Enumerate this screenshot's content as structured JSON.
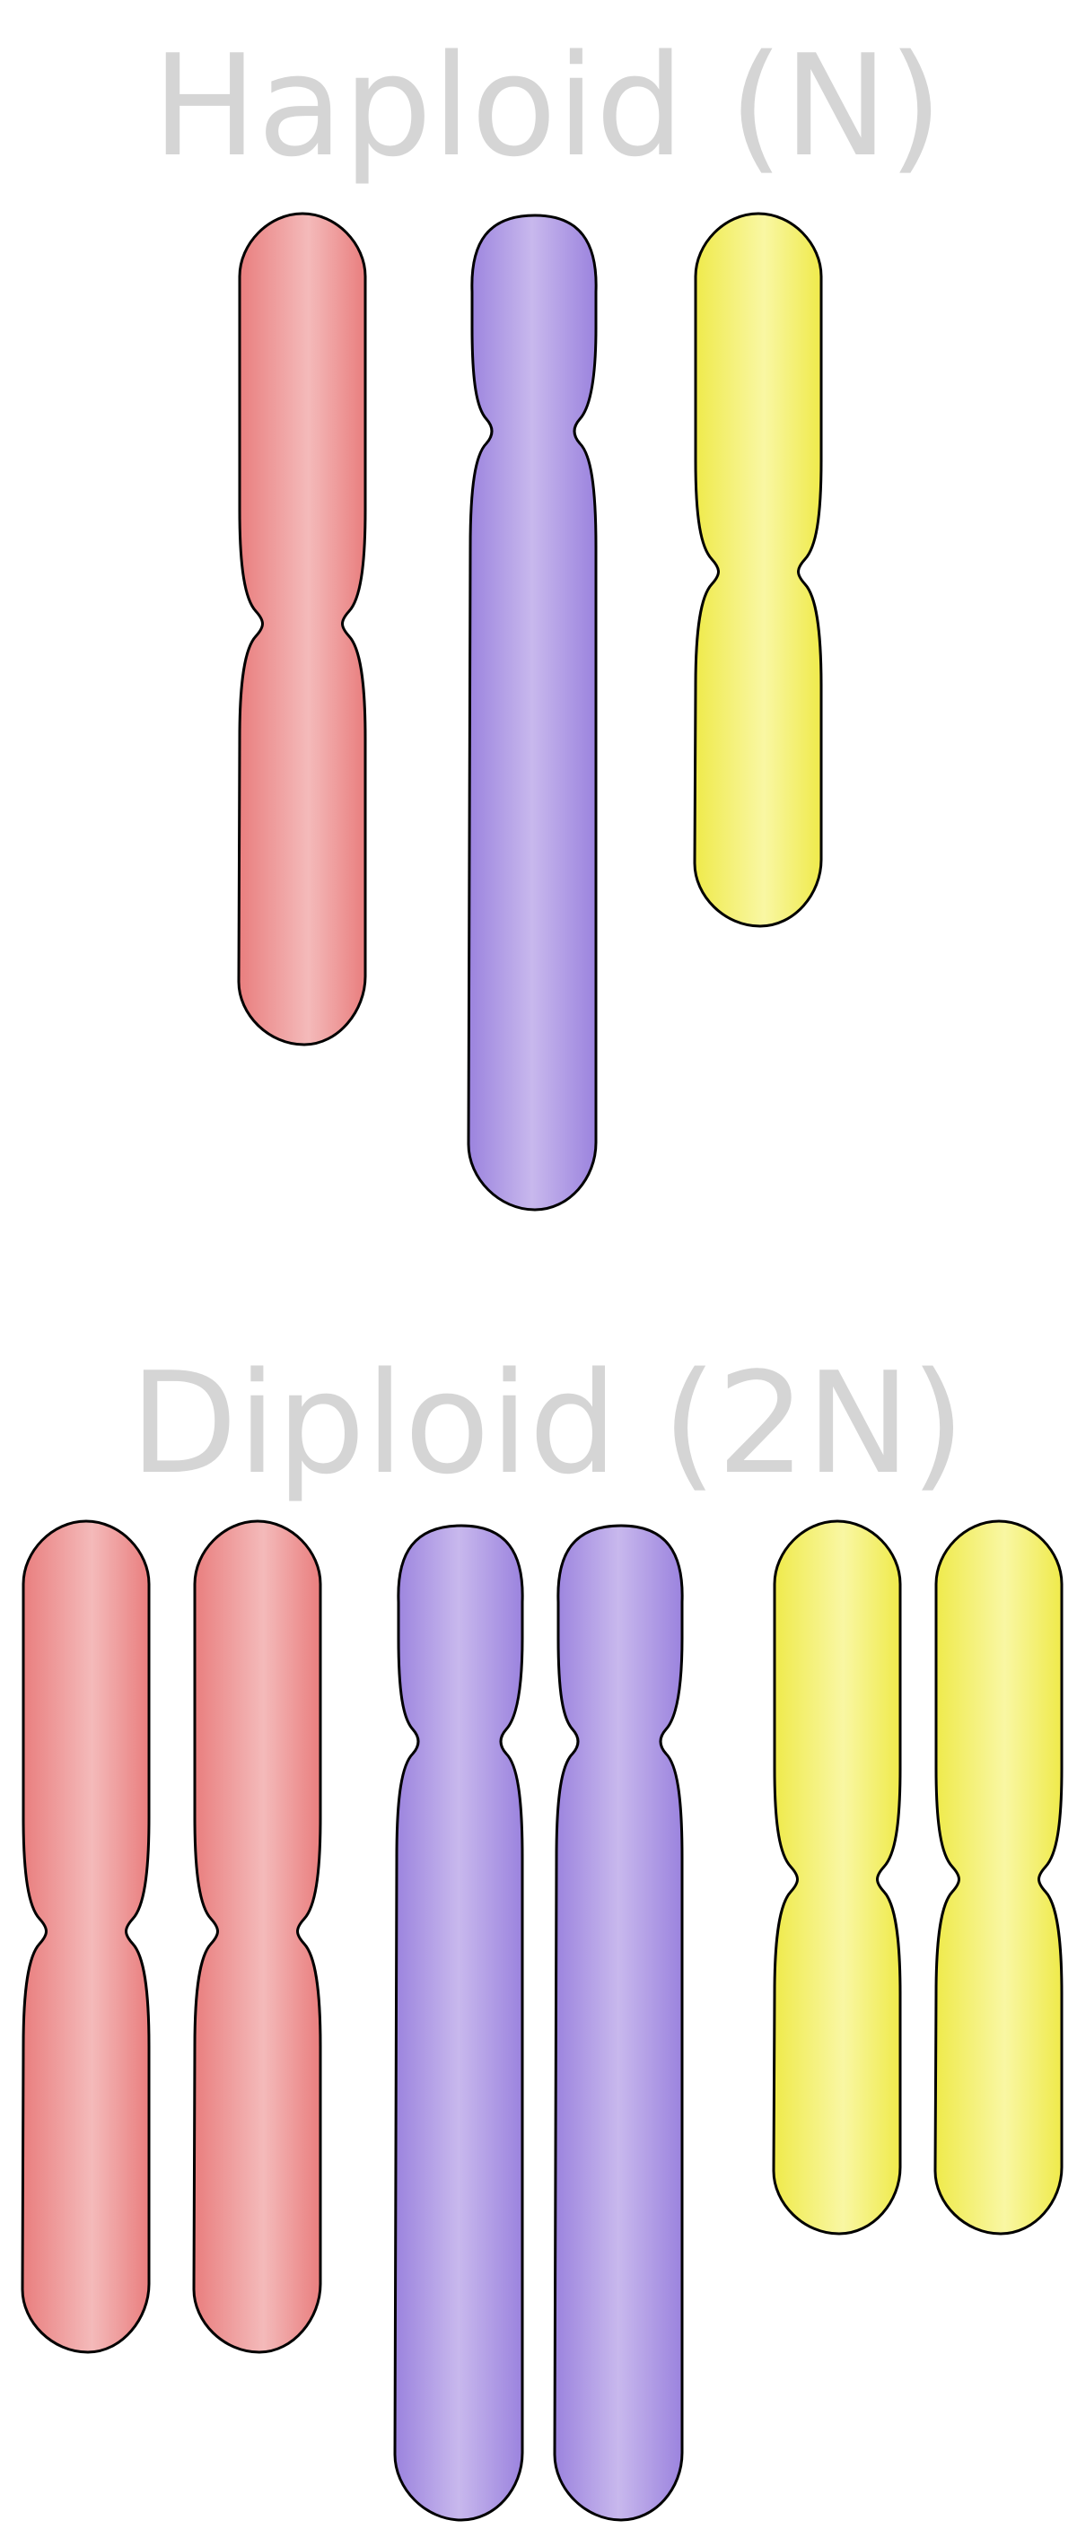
{
  "diagram": {
    "haploid_title": "Haploid (N)",
    "diploid_title": "Diploid (2N)"
  },
  "colors": {
    "red": {
      "edge": "#e97e7e",
      "mid": "#f4baba"
    },
    "purple": {
      "edge": "#9b83de",
      "mid": "#c8b8ed"
    },
    "yellow": {
      "edge": "#efea4b",
      "mid": "#f9f7a3"
    },
    "title": "#d5d5d5",
    "outline": "#000000"
  },
  "haploid_set": [
    {
      "name": "red",
      "centromere": "metacentric"
    },
    {
      "name": "purple",
      "centromere": "submetacentric"
    },
    {
      "name": "yellow",
      "centromere": "submetacentric"
    }
  ],
  "diploid_set": [
    {
      "name": "red",
      "copies": 2
    },
    {
      "name": "purple",
      "copies": 2
    },
    {
      "name": "yellow",
      "copies": 2
    }
  ]
}
